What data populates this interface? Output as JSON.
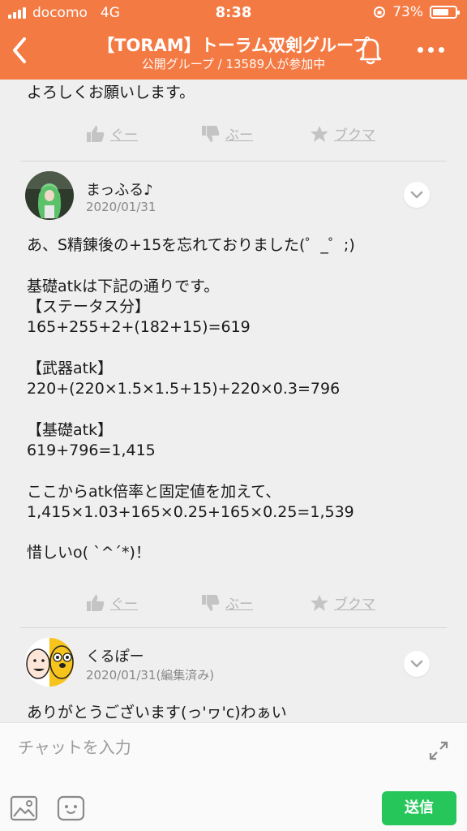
{
  "status": {
    "carrier": "docomo",
    "network": "4G",
    "time": "8:38",
    "battery_pct": "73%",
    "battery_level": 0.73
  },
  "header": {
    "title": "【TORAM】トーラム双剣グループ",
    "subtitle": "公開グループ / 13589人が参加中",
    "color": "#f47a44"
  },
  "messages": [
    {
      "text": "よろしくお願いします。",
      "reactions": {
        "like": "ぐー",
        "dislike": "ぶー",
        "bookmark": "ブクマ"
      }
    },
    {
      "author": "まっふる♪",
      "date": "2020/01/31",
      "text": "あ、S精錬後の+15を忘れておりました(゜_゜;)\n\n基礎atkは下記の通りです。\n【ステータス分】\n165+255+2+(182+15)=619\n\n【武器atk】\n220+(220×1.5×1.5+15)+220×0.3=796\n\n【基礎atk】\n619+796=1,415\n\nここからatk倍率と固定値を加えて、\n1,415×1.03+165×0.25+165×0.25=1,539\n\n惜しいo( ˋ^ˊ*)！",
      "reactions": {
        "like": "ぐー",
        "dislike": "ぶー",
        "bookmark": "ブクマ"
      }
    },
    {
      "author": "くるぽー",
      "date": "2020/01/31(編集済み)",
      "text": "ありがとうございます(っ'ヮ'c)わぁい"
    }
  ],
  "input": {
    "placeholder": "チャットを入力",
    "send_label": "送信",
    "send_color": "#26c65a"
  }
}
